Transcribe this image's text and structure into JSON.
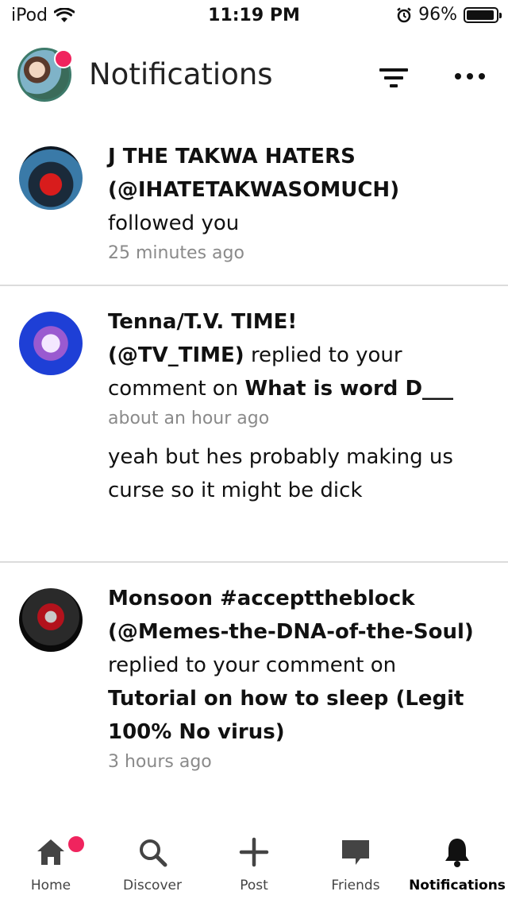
{
  "status_bar": {
    "carrier": "iPod",
    "time": "11:19 PM",
    "battery": "96%",
    "battery_level": 0.96
  },
  "header": {
    "title": "Notifications",
    "avatar_badge": true,
    "filter_icon": "filter-icon",
    "more_icon": "more-icon"
  },
  "notifications": [
    {
      "name": "J THE TAKWA HATERS",
      "handle": "(@IHATETAKWASOMUCH)",
      "action": "followed you",
      "time": "25 minutes ago"
    },
    {
      "name": "Tenna/T.V. TIME!",
      "handle": "(@TV_TIME)",
      "action": "replied to your comment on",
      "post": "What is word D___",
      "time": "about an hour ago",
      "comment": "yeah but hes probably making us curse so it might be dick"
    },
    {
      "name": "Monsoon #accepttheblock",
      "handle": "(@Memes-the-DNA-of-the-Soul)",
      "action": "replied to your comment on",
      "post": "Tutorial on how to sleep (Legit 100% No virus)",
      "time": "3 hours ago"
    }
  ],
  "tabbar": {
    "tabs": [
      {
        "label": "Home",
        "icon": "home-icon",
        "badge": true
      },
      {
        "label": "Discover",
        "icon": "search-icon"
      },
      {
        "label": "Post",
        "icon": "plus-icon"
      },
      {
        "label": "Friends",
        "icon": "chat-icon"
      },
      {
        "label": "Notifications",
        "icon": "bell-icon",
        "active": true
      }
    ]
  },
  "colors": {
    "badge": "#f0245e",
    "divider": "#dcdcdc",
    "secondary_text": "#8a8a8a"
  }
}
